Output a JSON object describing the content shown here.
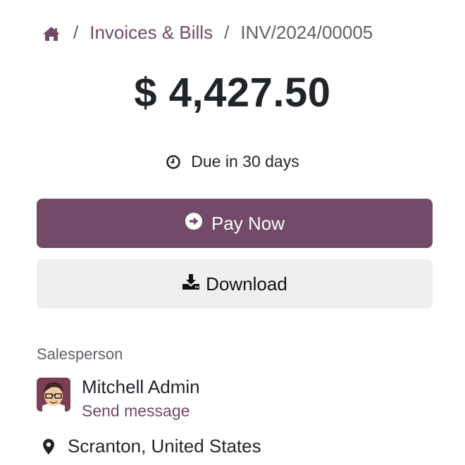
{
  "breadcrumb": {
    "home_icon": "home-icon",
    "separator": "/",
    "parent": "Invoices & Bills",
    "current": "INV/2024/00005"
  },
  "invoice": {
    "amount": "$ 4,427.50",
    "due_text": "Due in 30 days",
    "due_icon": "clock-icon"
  },
  "actions": {
    "pay_label": "Pay Now",
    "pay_icon": "arrow-circle-right-icon",
    "download_label": "Download",
    "download_icon": "download-icon"
  },
  "salesperson": {
    "label": "Salesperson",
    "name": "Mitchell Admin",
    "message_link": "Send message",
    "avatar_icon": "avatar"
  },
  "location": {
    "icon": "map-pin-icon",
    "text": "Scranton, United States"
  },
  "colors": {
    "brand": "#714B67",
    "secondary_button": "#efefef",
    "text": "#212529",
    "muted": "#5f6166"
  }
}
